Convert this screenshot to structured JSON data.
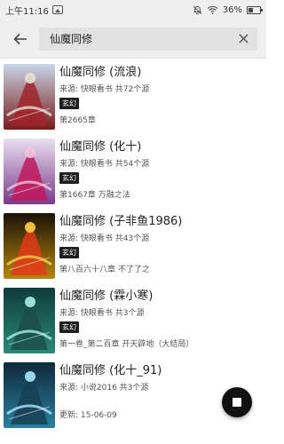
{
  "status_bar": {
    "time": "上午11:16",
    "battery_label": "36%",
    "battery_level": 0.36,
    "icons": [
      "image-icon",
      "mute-bell-icon",
      "wifi-icon",
      "battery-icon"
    ]
  },
  "toolbar": {
    "back_icon": "arrow-left-icon",
    "search_value": "仙魔同修",
    "clear_icon": "close-icon"
  },
  "results": [
    {
      "title": "仙魔同修 (流浪)",
      "source": "来源: 快眼看书  共72个源",
      "tag": "玄幻",
      "latest": "第2665章",
      "cover_theme": "red"
    },
    {
      "title": "仙魔同修 (化十)",
      "source": "来源: 快眼看书  共54个源",
      "tag": "玄幻",
      "latest": "第1667章 万融之法",
      "cover_theme": "pink"
    },
    {
      "title": "仙魔同修 (子非鱼1986)",
      "source": "来源: 快眼看书  共43个源",
      "tag": "玄幻",
      "latest": "第八百六十八章 不了了之",
      "cover_theme": "gold"
    },
    {
      "title": "仙魔同修 (霖小寒)",
      "source": "来源: 快眼看书  共3个源",
      "tag": "玄幻",
      "latest": "第一卷_第二百章 开天辟地（大结局）",
      "cover_theme": "teal"
    },
    {
      "title": "仙魔同修 (化十_91)",
      "source": "来源: 小说2016  共3个源",
      "tag": "",
      "latest": "更新: 15-06-09",
      "cover_theme": "cyan"
    }
  ],
  "fab_icon": "stop-icon"
}
